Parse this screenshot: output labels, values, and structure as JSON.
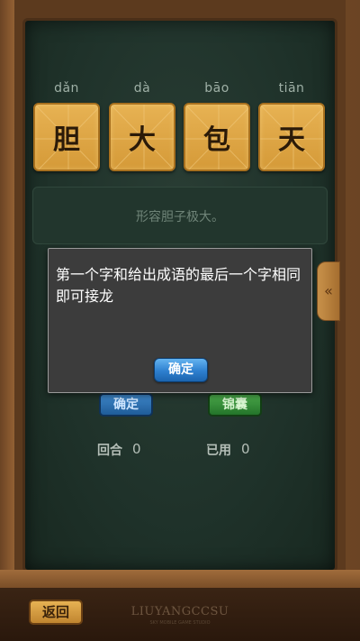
{
  "puzzle": {
    "pinyin": [
      "dǎn",
      "dà",
      "bāo",
      "tiān"
    ],
    "characters": [
      "胆",
      "大",
      "包",
      "天"
    ],
    "hint": "形容胆子极大。"
  },
  "controls": {
    "confirm_label": "确定",
    "tips_label": "锦囊",
    "side_tab_icon": "«"
  },
  "stats": {
    "round_label": "回合",
    "round_value": "0",
    "used_label": "已用",
    "used_value": "0"
  },
  "dialog": {
    "message": "第一个字和给出成语的最后一个字相同即可接龙",
    "ok_label": "确定"
  },
  "footer": {
    "back_label": "返回",
    "logo_text": "LIUYANGCCSU",
    "logo_subtext": "SKY MOBILE GAME STUDIO"
  },
  "colors": {
    "board": "#1f322a",
    "tile": "#d59a38",
    "dialog_bg": "#3c3c3c",
    "dialog_button": "#2d7fcf"
  }
}
